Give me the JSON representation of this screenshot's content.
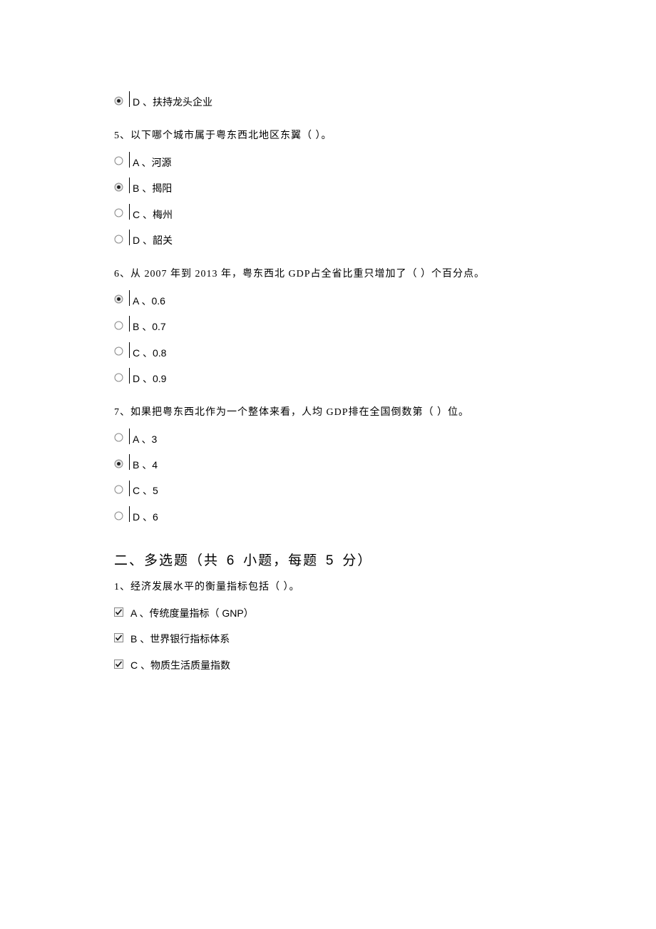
{
  "q4": {
    "option_d": "D 、扶持龙头企业"
  },
  "q5": {
    "stem": "5、以下哪个城市属于粤东西北地区东翼（       ）。",
    "a": "A 、河源",
    "b": "B 、揭阳",
    "c": "C 、梅州",
    "d": "D 、韶关"
  },
  "q6": {
    "stem": "6、从 2007 年到 2013 年，粤东西北   GDP占全省比重只增加了（     ）个百分点。",
    "a": "A 、0.6",
    "b": "B 、0.7",
    "c": "C 、0.8",
    "d": "D 、0.9"
  },
  "q7": {
    "stem": "7、如果把粤东西北作为一个整体来看，人均      GDP排在全国倒数第（     ）位。",
    "a": "A 、3",
    "b": "B 、4",
    "c": "C 、5",
    "d": "D 、6"
  },
  "section2": {
    "header_prefix": "二、多选题（共",
    "count": "6",
    "header_mid": "小题，每题",
    "points": "5",
    "header_suffix": "分）"
  },
  "mc1": {
    "stem": "1、经济发展水平的衡量指标包括（       ）。",
    "a": "A 、传统度量指标（  GNP）",
    "b": "B 、世界银行指标体系",
    "c": "C 、物质生活质量指数"
  }
}
